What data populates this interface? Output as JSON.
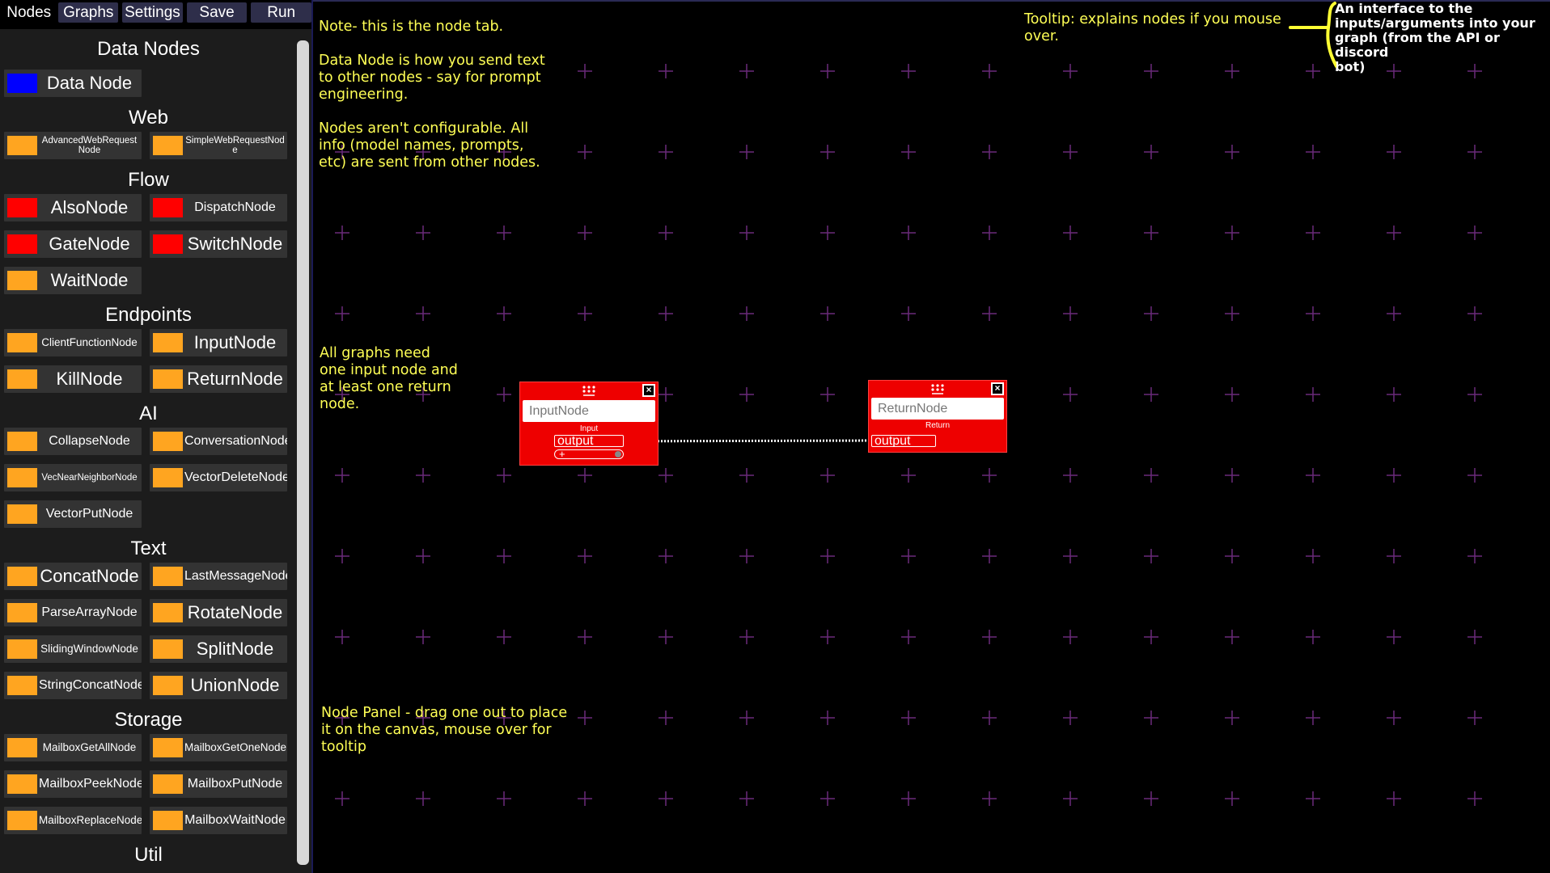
{
  "nav": {
    "tabs": [
      {
        "label": "Nodes"
      },
      {
        "label": "Graphs"
      },
      {
        "label": "Settings"
      },
      {
        "label": "Save"
      },
      {
        "label": "Run"
      }
    ]
  },
  "colors": {
    "data": "#0000ff",
    "web": "#ff9900",
    "flow": "#ff0000",
    "default": "#ffa520",
    "node_red": "#ee0000",
    "note_yellow": "#ffff55",
    "grid_cross": "#6a2a7a"
  },
  "sidebar": {
    "categories": [
      {
        "title": "Data Nodes",
        "items": [
          {
            "label": "Data Node",
            "color": "#0000ff"
          }
        ]
      },
      {
        "title": "Web",
        "items": [
          {
            "label": "AdvancedWebRequestNode",
            "color": "#ffa520"
          },
          {
            "label": "SimpleWebRequestNode",
            "color": "#ffa520"
          }
        ]
      },
      {
        "title": "Flow",
        "items": [
          {
            "label": "AlsoNode",
            "color": "#ff0000"
          },
          {
            "label": "DispatchNode",
            "color": "#ff0000"
          },
          {
            "label": "GateNode",
            "color": "#ff0000"
          },
          {
            "label": "SwitchNode",
            "color": "#ff0000"
          },
          {
            "label": "WaitNode",
            "color": "#ffa520"
          }
        ]
      },
      {
        "title": "Endpoints",
        "items": [
          {
            "label": "ClientFunctionNode",
            "color": "#ffa520"
          },
          {
            "label": "InputNode",
            "color": "#ffa520"
          },
          {
            "label": "KillNode",
            "color": "#ffa520"
          },
          {
            "label": "ReturnNode",
            "color": "#ffa520"
          }
        ]
      },
      {
        "title": "AI",
        "items": [
          {
            "label": "CollapseNode",
            "color": "#ffa520"
          },
          {
            "label": "ConversationNode",
            "color": "#ffa520"
          },
          {
            "label": "VecNearNeighborNode",
            "color": "#ffa520"
          },
          {
            "label": "VectorDeleteNode",
            "color": "#ffa520"
          },
          {
            "label": "VectorPutNode",
            "color": "#ffa520"
          }
        ]
      },
      {
        "title": "Text",
        "items": [
          {
            "label": "ConcatNode",
            "color": "#ffa520"
          },
          {
            "label": "LastMessageNode",
            "color": "#ffa520"
          },
          {
            "label": "ParseArrayNode",
            "color": "#ffa520"
          },
          {
            "label": "RotateNode",
            "color": "#ffa520"
          },
          {
            "label": "SlidingWindowNode",
            "color": "#ffa520"
          },
          {
            "label": "SplitNode",
            "color": "#ffa520"
          },
          {
            "label": "StringConcatNode",
            "color": "#ffa520"
          },
          {
            "label": "UnionNode",
            "color": "#ffa520"
          }
        ]
      },
      {
        "title": "Storage",
        "items": [
          {
            "label": "MailboxGetAllNode",
            "color": "#ffa520"
          },
          {
            "label": "MailboxGetOneNode",
            "color": "#ffa520"
          },
          {
            "label": "MailboxPeekNode",
            "color": "#ffa520"
          },
          {
            "label": "MailboxPutNode",
            "color": "#ffa520"
          },
          {
            "label": "MailboxReplaceNode",
            "color": "#ffa520"
          },
          {
            "label": "MailboxWaitNode",
            "color": "#ffa520"
          }
        ]
      },
      {
        "title": "Util",
        "items": []
      }
    ]
  },
  "notes": {
    "node_tab": "Note- this is the node tab.\n\nData Node is how you send text\nto other nodes - say for prompt\nengineering.\n\nNodes aren't configurable. All\ninfo (model names, prompts,\netc) are sent from other nodes.",
    "tooltip": "Tooltip: explains nodes if you mouse\nover.",
    "interface": "An interface to the\ninputs/arguments into your\ngraph (from the API or discord\nbot)",
    "graphs_need": "All graphs need\none input node and\nat least one return\nnode.",
    "node_panel": "Node Panel - drag one out to place\nit on the canvas, mouse over for\ntooltip"
  },
  "graph": {
    "input_node": {
      "name": "InputNode",
      "type_label": "Input",
      "output_label": "output",
      "add_label": "+"
    },
    "return_node": {
      "name": "ReturnNode",
      "type_label": "Return",
      "input_label": "output"
    }
  }
}
